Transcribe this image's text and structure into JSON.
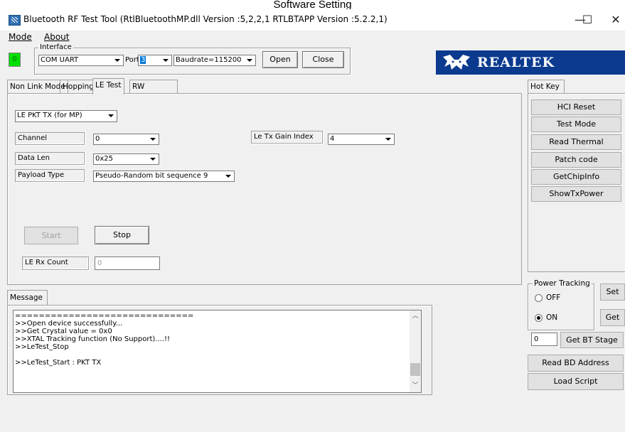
{
  "caption": "Software Setting",
  "window": {
    "title": "Bluetooth RF Test Tool (RtlBluetoothMP.dll Version :5,2,2,1    RTLBTAPP Version :5.2.2,1)",
    "minimize": "—",
    "maximize": "☐",
    "close": "✕"
  },
  "menu": {
    "mode": "Mode",
    "about": "About"
  },
  "interface": {
    "group_label": "Interface",
    "indicator": "0",
    "indicator_color": "#00e000",
    "conn_type": "COM UART",
    "port_label": "Port",
    "port_value": "3",
    "baudrate": "Baudrate=115200",
    "open": "Open",
    "close": "Close"
  },
  "brand": {
    "logo_text": "REALTEK",
    "color": "#0b3a8f"
  },
  "tabs": [
    "Non Link Mode",
    "Hopping",
    "LE Test",
    "RW"
  ],
  "active_tab": "LE Test",
  "le_test": {
    "mode": "LE PKT TX (for MP)",
    "channel_label": "Channel",
    "channel_value": "0",
    "datalen_label": "Data Len",
    "datalen_value": "0x25",
    "payload_label": "Payload Type",
    "payload_value": "Pseudo-Random bit sequence 9",
    "gain_label": "Le Tx Gain Index",
    "gain_value": "4",
    "start": "Start",
    "stop": "Stop",
    "rx_count_label": "LE Rx Count",
    "rx_count_value": "0"
  },
  "hotkey": {
    "tab": "Hot Key",
    "buttons": [
      "HCI Reset",
      "Test Mode",
      "Read Thermal",
      "Patch code",
      "GetChipInfo",
      "ShowTxPower"
    ]
  },
  "power_tracking": {
    "label": "Power Tracking",
    "off": "OFF",
    "on": "ON",
    "selected": "ON",
    "set": "Set",
    "get": "Get",
    "stage_value": "0",
    "get_bt_stage": "Get BT Stage"
  },
  "bottom_buttons": {
    "read_bd": "Read BD Address",
    "load_script": "Load Script"
  },
  "message": {
    "tab": "Message",
    "lines": "==============================\n>>Open device successfully...\n>>Get Crystal value = 0x0\n>>XTAL Tracking function (No Support)....!!\n>>LeTest_Stop\n\n>>LeTest_Start : PKT TX"
  }
}
